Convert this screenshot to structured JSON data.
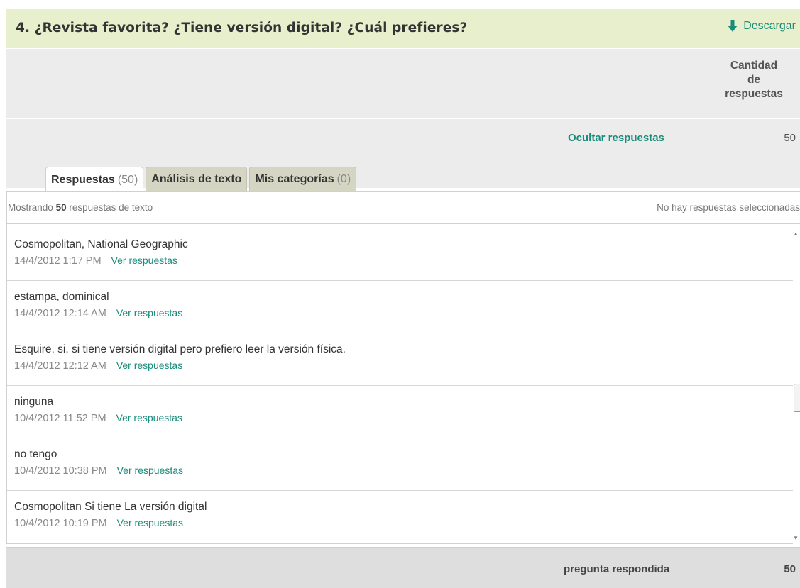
{
  "question": {
    "title": "4. ¿Revista favorita? ¿Tiene versión digital? ¿Cuál prefieres?",
    "download_label": "Descargar",
    "download_icon": "arrow-down-icon"
  },
  "columns": {
    "count_header_line1": "Cantidad",
    "count_header_line2": "de",
    "count_header_line3": "respuestas"
  },
  "answers_row": {
    "hide_link": "Ocultar respuestas",
    "count": "50"
  },
  "tabs": [
    {
      "label": "Respuestas",
      "count": "(50)"
    },
    {
      "label": "Análisis de texto",
      "count": ""
    },
    {
      "label": "Mis categorías",
      "count": "(0)"
    }
  ],
  "panel": {
    "showing_prefix": "Mostrando",
    "showing_count": "50",
    "showing_suffix": "respuestas de texto",
    "no_selection": "No hay respuestas seleccionadas"
  },
  "responses": [
    {
      "text": "Cosmopolitan, National Geographic",
      "date": "14/4/2012 1:17 PM",
      "link": "Ver respuestas"
    },
    {
      "text": "estampa, dominical",
      "date": "14/4/2012 12:14 AM",
      "link": "Ver respuestas"
    },
    {
      "text": "Esquire, si, si tiene versión digital pero prefiero leer la versión física.",
      "date": "14/4/2012 12:12 AM",
      "link": "Ver respuestas"
    },
    {
      "text": "ninguna",
      "date": "10/4/2012 11:52 PM",
      "link": "Ver respuestas"
    },
    {
      "text": "no tengo",
      "date": "10/4/2012 10:38 PM",
      "link": "Ver respuestas"
    },
    {
      "text": "Cosmopolitan Si tiene La versión digital",
      "date": "10/4/2012 10:19 PM",
      "link": "Ver respuestas"
    }
  ],
  "footer": {
    "label": "pregunta respondida",
    "count": "50"
  },
  "colors": {
    "header_bg": "#e7efcc",
    "accent": "#1a8c7a",
    "subheader_bg": "#ececec",
    "footer_bg": "#dedede"
  }
}
